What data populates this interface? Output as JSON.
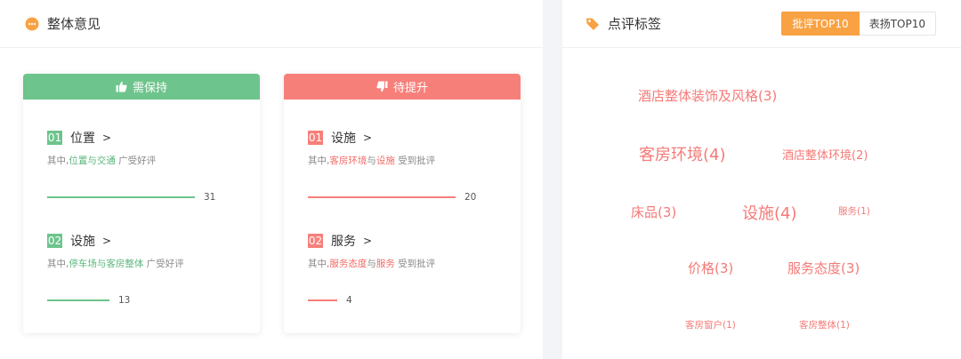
{
  "left": {
    "title": "整体意见",
    "keep": {
      "header": "需保持",
      "items": [
        {
          "num": "01",
          "title": "位置",
          "chevron": ">",
          "desc_prefix": "其中,",
          "hl1": "位置",
          "joiner": "与",
          "hl2": "交通",
          "desc_suffix": " 广受好评",
          "count": "31",
          "ratio": 1.0
        },
        {
          "num": "02",
          "title": "设施",
          "chevron": ">",
          "desc_prefix": "其中,",
          "hl1": "停车场",
          "joiner": "与",
          "hl2": "客房整体",
          "desc_suffix": " 广受好评",
          "count": "13",
          "ratio": 0.42
        }
      ]
    },
    "improve": {
      "header": "待提升",
      "items": [
        {
          "num": "01",
          "title": "设施",
          "chevron": ">",
          "desc_prefix": "其中,",
          "hl1": "客房环境",
          "joiner": "与",
          "hl2": "设施",
          "desc_suffix": " 受到批评",
          "count": "20",
          "ratio": 1.0
        },
        {
          "num": "02",
          "title": "服务",
          "chevron": ">",
          "desc_prefix": "其中,",
          "hl1": "服务态度",
          "joiner": "与",
          "hl2": "服务",
          "desc_suffix": " 受到批评",
          "count": "4",
          "ratio": 0.2
        }
      ]
    }
  },
  "right": {
    "title": "点评标签",
    "tabs": {
      "active": "批评TOP10",
      "inactive": "表扬TOP10"
    },
    "tags": [
      "酒店整体装饰及风格(3)",
      "客房环境(4)",
      "酒店整体环境(2)",
      "床品(3)",
      "设施(4)",
      "服务(1)",
      "价格(3)",
      "服务态度(3)",
      "客房窗户(1)",
      "客房整体(1)"
    ]
  },
  "colors": {
    "accent": "#f9a243",
    "positive": "#6dc48c",
    "negative": "#f77f7a",
    "tag": "#f47a77"
  },
  "icons": {
    "opinion": "speech-bubble-icon",
    "tag": "tag-icon",
    "keep": "thumbs-up-icon",
    "improve": "thumbs-down-icon"
  }
}
